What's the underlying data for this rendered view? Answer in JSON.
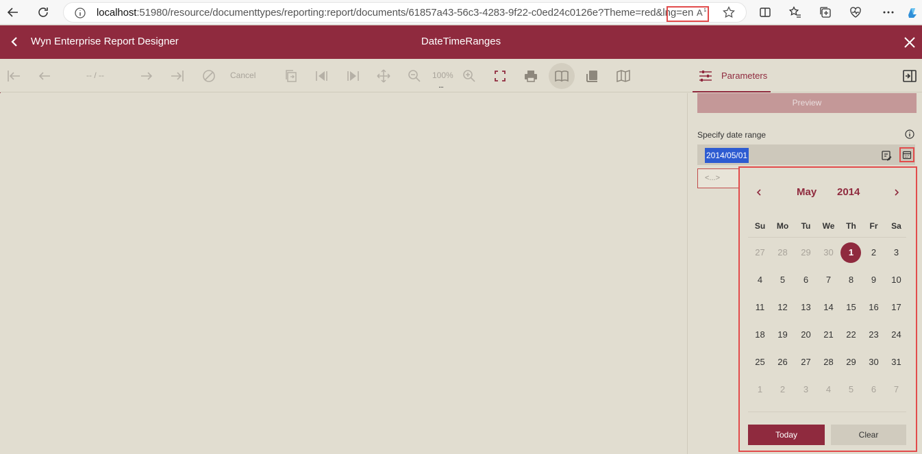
{
  "browser": {
    "url_host": "localhost",
    "url_rest": ":51980/resource/documenttypes/reporting:report/documents/61857a43-56c3-4283-9f22-c0ed24c0126e?Theme=red&lng=en"
  },
  "header": {
    "app_title": "Wyn Enterprise Report Designer",
    "doc_title": "DateTimeRanges"
  },
  "toolbar": {
    "page_indicator": "-- / --",
    "cancel_label": "Cancel",
    "zoom_label": "100%",
    "zoom_more": "..."
  },
  "sidepanel": {
    "tab_label": "Parameters",
    "preview_label": "Preview",
    "param_label": "Specify date range",
    "date_value": "2014/05/01",
    "range_placeholder": "<...>"
  },
  "calendar": {
    "month": "May",
    "year": "2014",
    "weekdays": [
      "Su",
      "Mo",
      "Tu",
      "We",
      "Th",
      "Fr",
      "Sa"
    ],
    "weeks": [
      [
        "27",
        "28",
        "29",
        "30",
        "1",
        "2",
        "3"
      ],
      [
        "4",
        "5",
        "6",
        "7",
        "8",
        "9",
        "10"
      ],
      [
        "11",
        "12",
        "13",
        "14",
        "15",
        "16",
        "17"
      ],
      [
        "18",
        "19",
        "20",
        "21",
        "22",
        "23",
        "24"
      ],
      [
        "25",
        "26",
        "27",
        "28",
        "29",
        "30",
        "31"
      ],
      [
        "1",
        "2",
        "3",
        "4",
        "5",
        "6",
        "7"
      ]
    ],
    "selected_day": "1",
    "today_label": "Today",
    "clear_label": "Clear"
  },
  "colors": {
    "accent": "#8f2a3e",
    "highlight_border": "#e24b4b",
    "background": "#e1ddd0",
    "selection": "#2d5bd1"
  }
}
